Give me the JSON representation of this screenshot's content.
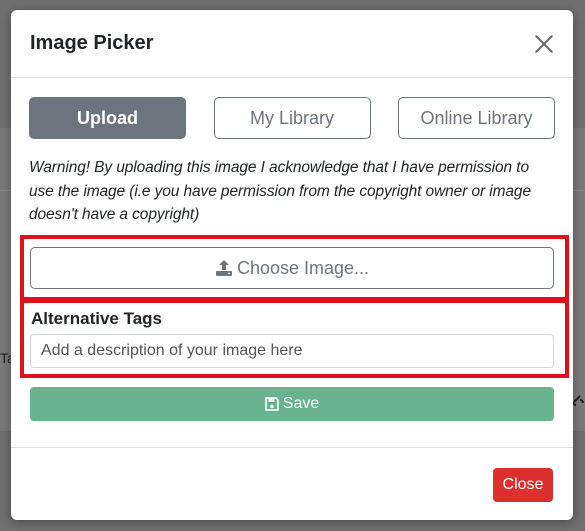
{
  "modal": {
    "title": "Image Picker",
    "tabs": [
      {
        "label": "Upload",
        "active": true
      },
      {
        "label": "My Library",
        "active": false
      },
      {
        "label": "Online Library",
        "active": false
      }
    ],
    "warning": "Warning! By uploading this image I acknowledge that I have permission to use the image (i.e you have permission from the copyright owner or image doesn't have a copyright)",
    "choose_button": {
      "label": "Choose Image...",
      "icon": "upload-icon"
    },
    "alt_tags": {
      "label": "Alternative Tags",
      "placeholder": "Add a description of your image here",
      "value": ""
    },
    "save_button": {
      "label": "Save",
      "icon": "save-icon"
    },
    "close_button": {
      "label": "Close"
    }
  },
  "backdrop": {
    "partial_text": "Ta"
  },
  "colors": {
    "active_tab": "#6c757d",
    "save": "#6ab391",
    "close": "#dc3030",
    "highlight": "#e0101c"
  }
}
